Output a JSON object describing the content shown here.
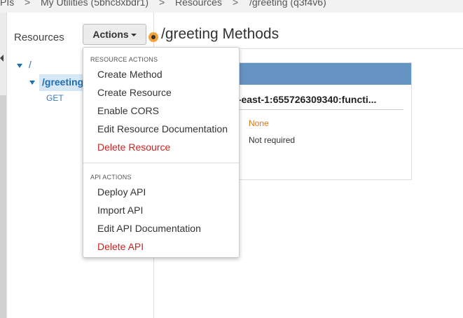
{
  "breadcrumb": [
    {
      "label": "PIs"
    },
    {
      "label": "My Utilities (5bhc8xbdr1)"
    },
    {
      "label": "Resources"
    },
    {
      "label": "/greeting (q3f4v6)"
    }
  ],
  "breadcrumb_sep": ">",
  "resources_panel": {
    "title": "Resources",
    "actions_label": "Actions",
    "tree": {
      "root": "/",
      "child": "/greeting",
      "method": "GET"
    }
  },
  "main": {
    "title": "/greeting Methods",
    "card": {
      "arn": "a:us-east-1:655726309340:functi...",
      "authorization": "None",
      "api_key": "Not required"
    }
  },
  "dropdown": {
    "resource_actions_label": "RESOURCE ACTIONS",
    "resource_actions": [
      {
        "label": "Create Method"
      },
      {
        "label": "Create Resource"
      },
      {
        "label": "Enable CORS"
      },
      {
        "label": "Edit Resource Documentation"
      },
      {
        "label": "Delete Resource"
      }
    ],
    "api_actions_label": "API ACTIONS",
    "api_actions": [
      {
        "label": "Deploy API"
      },
      {
        "label": "Import API"
      },
      {
        "label": "Edit API Documentation"
      },
      {
        "label": "Delete API"
      }
    ]
  },
  "colors": {
    "link_blue": "#1f6fb2",
    "card_header": "#6593c2",
    "danger_red": "#d0211c",
    "auth_orange": "#d5781d"
  }
}
